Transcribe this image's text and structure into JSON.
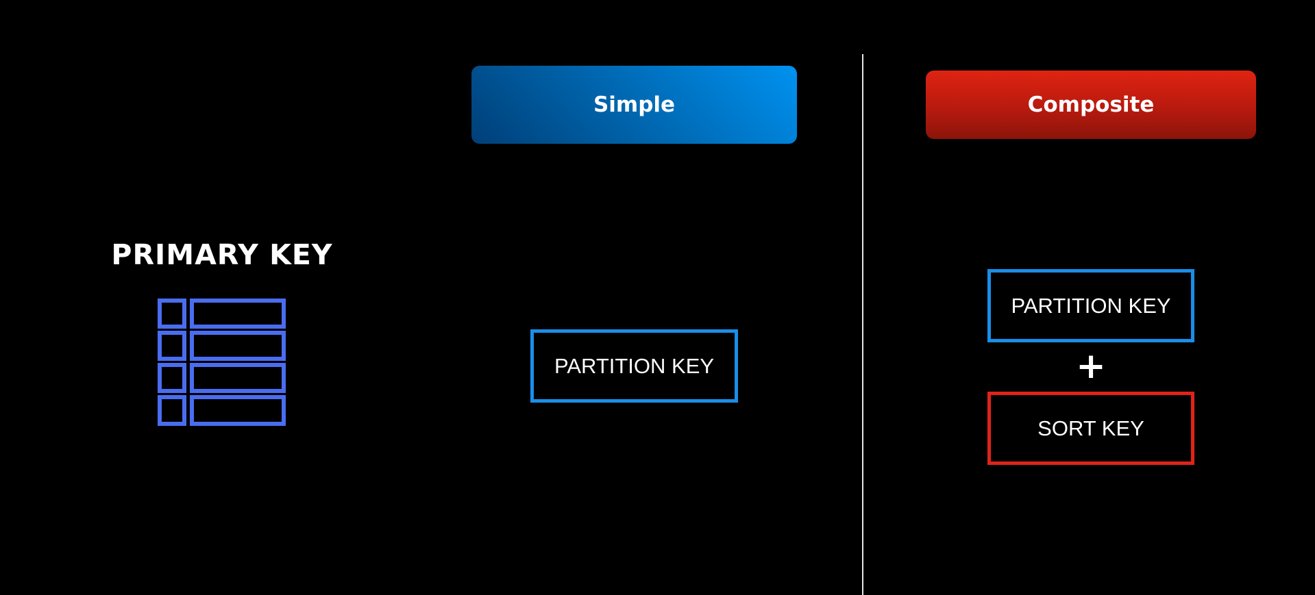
{
  "primary_key": {
    "title": "PRIMARY KEY",
    "icon": "table-rows-icon",
    "icon_color": "#4a6df0"
  },
  "simple": {
    "header": "Simple",
    "partition_key": "PARTITION KEY",
    "accent_color": "#1a8ee8"
  },
  "composite": {
    "header": "Composite",
    "partition_key": "PARTITION KEY",
    "plus": "+",
    "sort_key": "SORT KEY",
    "partition_color": "#1a8ee8",
    "sort_color": "#e0231a"
  }
}
